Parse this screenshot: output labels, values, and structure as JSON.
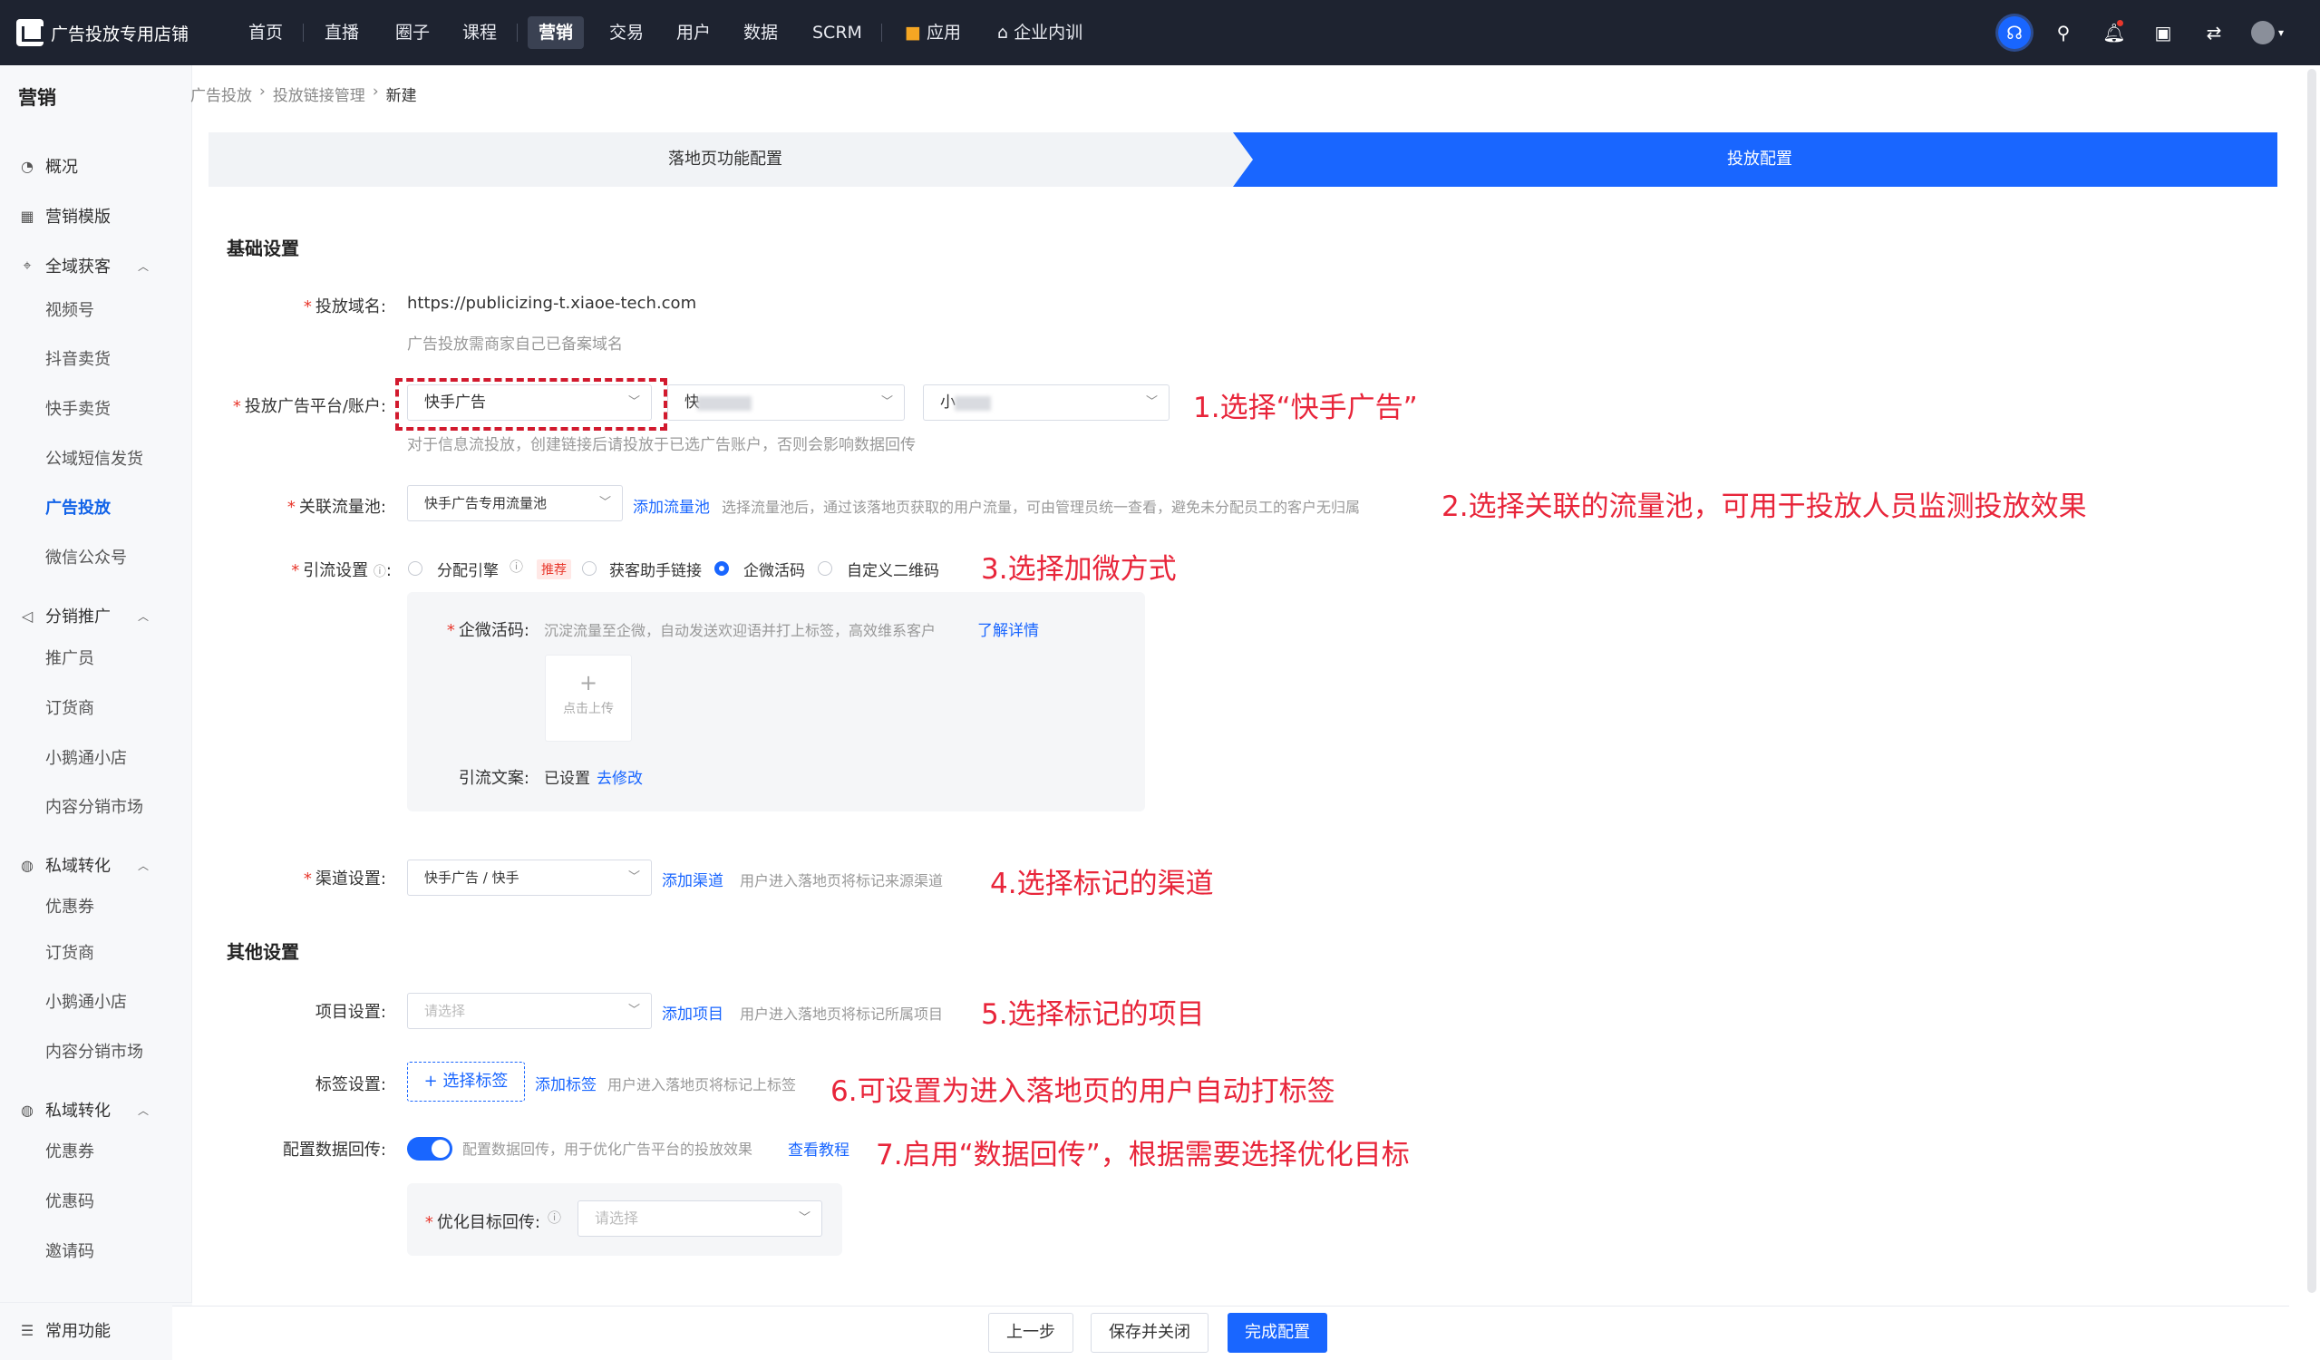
{
  "topnav": {
    "store_name": "广告投放专用店铺",
    "items": [
      "首页",
      "直播",
      "圈子",
      "课程",
      "营销",
      "交易",
      "用户",
      "数据",
      "SCRM",
      "应用",
      "企业内训"
    ],
    "active": "营销"
  },
  "sidebar": {
    "title": "营销",
    "groups": [
      {
        "label": "概况",
        "icon": "gauge-icon"
      },
      {
        "label": "营销模版",
        "icon": "grid-icon"
      },
      {
        "label": "全域获客",
        "icon": "target-icon",
        "subs": [
          "视频号",
          "抖音卖货",
          "快手卖货",
          "公域短信发货",
          "广告投放",
          "微信公众号"
        ]
      },
      {
        "label": "分销推广",
        "icon": "megaphone-icon",
        "subs": [
          "推广员",
          "订货商",
          "小鹅通小店",
          "内容分销市场"
        ]
      },
      {
        "label": "私域转化",
        "icon": "cycle-icon",
        "subs": [
          "优惠券",
          "订货商",
          "小鹅通小店",
          "内容分销市场"
        ]
      },
      {
        "label": "私域转化",
        "icon": "cycle-icon",
        "subs": [
          "优惠券",
          "优惠码",
          "邀请码"
        ]
      }
    ],
    "active_sub": "广告投放",
    "bottom": "常用功能"
  },
  "breadcrumb": [
    "广告投放",
    "投放链接管理",
    "新建"
  ],
  "steps": [
    "落地页功能配置",
    "投放配置"
  ],
  "basic": {
    "title": "基础设置",
    "domain_label": "投放域名:",
    "domain_value": "https://publicizing-t.xiaoe-tech.com",
    "domain_hint": "广告投放需商家自己已备案域名",
    "platform_label": "投放广告平台/账户:",
    "platform_value": "快手广告",
    "account_value": "快",
    "account2_value": "小",
    "platform_hint": "对于信息流投放，创建链接后请投放于已选广告账户，否则会影响数据回传",
    "pool_label": "关联流量池:",
    "pool_value": "快手广告专用流量池",
    "pool_link": "添加流量池",
    "pool_hint": "选择流量池后，通过该落地页获取的用户流量，可由管理员统一查看，避免未分配员工的客户无归属",
    "lead_label": "引流设置",
    "lead_options": [
      "分配引擎",
      "获客助手链接",
      "企微活码",
      "自定义二维码"
    ],
    "lead_recommend": "推荐",
    "qw_label": "企微活码:",
    "qw_hint": "沉淀流量至企微，自动发送欢迎语并打上标签，高效维系客户",
    "qw_link": "了解详情",
    "upload_plus": "+",
    "upload_text": "点击上传",
    "copy_label": "引流文案:",
    "copy_value": "已设置",
    "copy_link": "去修改",
    "channel_label": "渠道设置:",
    "channel_value": "快手广告 / 快手",
    "channel_link": "添加渠道",
    "channel_hint": "用户进入落地页将标记来源渠道"
  },
  "other": {
    "title": "其他设置",
    "project_label": "项目设置:",
    "project_placeholder": "请选择",
    "project_link": "添加项目",
    "project_hint": "用户进入落地页将标记所属项目",
    "tag_label": "标签设置:",
    "tag_button": "+ 选择标签",
    "tag_link": "添加标签",
    "tag_hint": "用户进入落地页将标记上标签",
    "callback_label": "配置数据回传:",
    "callback_hint": "配置数据回传，用于优化广告平台的投放效果",
    "callback_link": "查看教程",
    "callback_on": true,
    "opt_label": "优化目标回传:",
    "opt_placeholder": "请选择"
  },
  "annotations": [
    "1.选择“快手广告”",
    "2.选择关联的流量池，可用于投放人员监测投放效果",
    "3.选择加微方式",
    "4.选择标记的渠道",
    "5.选择标记的项目",
    "6.可设置为进入落地页的用户自动打标签",
    "7.启用“数据回传”，根据需要选择优化目标"
  ],
  "footer": {
    "prev": "上一步",
    "save_close": "保存并关闭",
    "finish": "完成配置"
  },
  "colors": {
    "primary": "#1966ff",
    "topbar": "#1e2330",
    "annotation": "#e8253a"
  }
}
